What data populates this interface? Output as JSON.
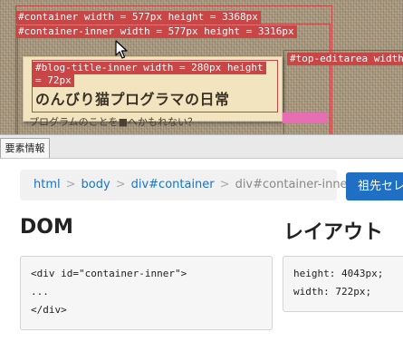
{
  "overlay": {
    "container_label": "#container width = 577px height = 3368px",
    "container_inner_label": "#container-inner width = 577px height = 3316px",
    "blog_title_inner_label_1": "#blog-title-inner width = 280px height",
    "blog_title_inner_label_2": "= 72px",
    "top_editarea_label": "#top-editarea width"
  },
  "page": {
    "blog_title": "のんびり猫プログラマの日常",
    "blog_description": "プログラムのことを■へかもれない？"
  },
  "devtools": {
    "tab_label": "要素情報",
    "breadcrumb": [
      "html",
      "body",
      "div#container",
      "div#container-inner"
    ],
    "ancestor_button": "祖先セレ",
    "dom_heading": "DOM",
    "dom_code": "<div id=\"container-inner\">\n...\n</div>",
    "layout_heading": "レイアウト",
    "layout_code": "height: 4043px;\nwidth: 722px;"
  },
  "colors": {
    "overlay_red": "#c94646",
    "link_blue": "#1a73c7",
    "button_blue": "#1f6fc5"
  }
}
